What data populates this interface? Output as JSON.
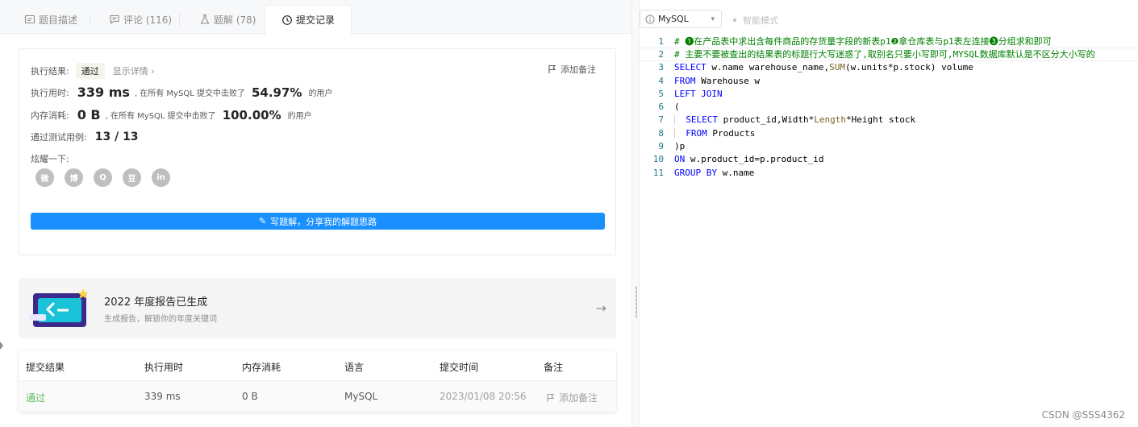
{
  "tabs": [
    {
      "label": "题目描述",
      "icon": "description-icon"
    },
    {
      "label": "评论 (116)",
      "icon": "comment-icon"
    },
    {
      "label": "题解 (78)",
      "icon": "flask-icon"
    },
    {
      "label": "提交记录",
      "icon": "clock-icon"
    }
  ],
  "result": {
    "label_result": "执行结果:",
    "status": "通过",
    "show_detail": "显示详情",
    "add_note": "添加备注",
    "runtime_label": "执行用时:",
    "runtime_value": "339 ms",
    "runtime_desc": ", 在所有 MySQL 提交中击败了",
    "runtime_pct": "54.97%",
    "runtime_suffix": "的用户",
    "memory_label": "内存消耗:",
    "memory_value": "0 B",
    "memory_desc": ", 在所有 MySQL 提交中击败了",
    "memory_pct": "100.00%",
    "memory_suffix": "的用户",
    "tests_label": "通过测试用例:",
    "tests_value": "13 / 13",
    "share_label": "炫耀一下:",
    "share_icons": [
      "wechat-icon",
      "weibo-icon",
      "qq-icon",
      "douban-icon",
      "linkedin-icon"
    ],
    "share_glyphs": [
      "微",
      "博",
      "Q",
      "豆",
      "in"
    ],
    "write_btn": "写题解，分享我的解题思路"
  },
  "banner": {
    "title": "2022 年度报告已生成",
    "subtitle": "生成报告，解锁你的年度关键词"
  },
  "table": {
    "headers": [
      "提交结果",
      "执行用时",
      "内存消耗",
      "语言",
      "提交时间",
      "备注"
    ],
    "row": {
      "status": "通过",
      "runtime": "339 ms",
      "memory": "0 B",
      "language": "MySQL",
      "time": "2023/01/08 20:56",
      "note": "添加备注"
    }
  },
  "editor": {
    "language": "MySQL",
    "smart_mode": "智能模式"
  },
  "code_lines": [
    "# ❶在产品表中求出含每件商品的存货量字段的新表p1❷拿仓库表与p1表左连接❸分组求和即可",
    "# 主要不要被查出的结果表的标题行大写迷惑了,取别名只要小写即可,MYSQL数据库默认是不区分大小写的",
    "SELECT w.name warehouse_name,SUM(w.units*p.stock) volume",
    "FROM Warehouse w",
    "LEFT JOIN",
    "(",
    "  SELECT product_id,Width*Length*Height stock",
    "  FROM Products",
    ")p",
    "ON w.product_id=p.product_id",
    "GROUP BY w.name"
  ],
  "watermark": "CSDN @SSS4362",
  "colors": {
    "accent": "#1a90ff",
    "success": "#5cb85c"
  }
}
